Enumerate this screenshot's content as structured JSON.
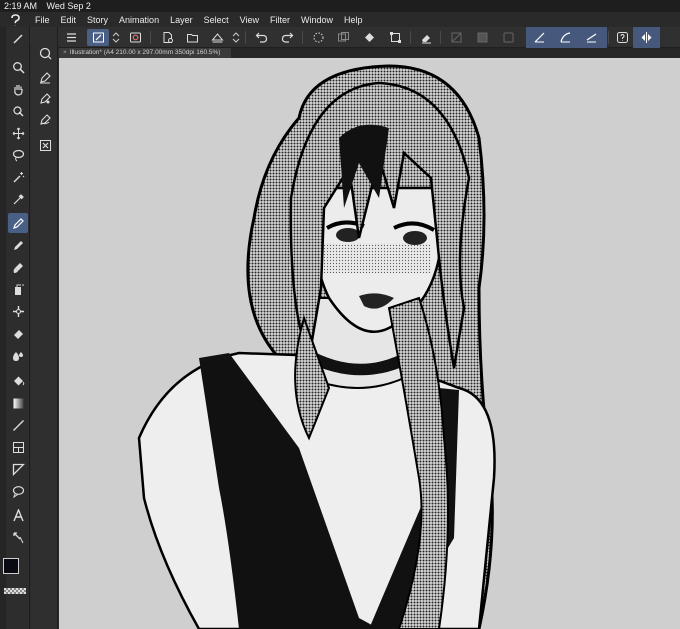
{
  "status": {
    "time": "2:19 AM",
    "date": "Wed Sep 2"
  },
  "menu": [
    "File",
    "Edit",
    "Story",
    "Animation",
    "Layer",
    "Select",
    "View",
    "Filter",
    "Window",
    "Help"
  ],
  "document": {
    "tab_title": "Illustration* (A4 210.00 x 297.00mm 350dpi 160.5%)"
  },
  "colors": {
    "main": "#0a0a14",
    "sub": "#ffffff",
    "accent": "#4a5f86"
  },
  "toolbar_icons": [
    "menu-icon",
    "layer-property-icon",
    "convert-icon",
    "new-icon",
    "open-icon",
    "save-icon",
    "undo-icon",
    "redo-icon",
    "loading-icon",
    "layer-icon",
    "fill-icon",
    "transform-icon",
    "eraser-icon",
    "ruler-snap-icon",
    "contour-snap-icon",
    "perspective-snap-icon",
    "help-icon",
    "flip-icon"
  ],
  "tools": [
    "zoom-icon",
    "hand-icon",
    "rotate-icon",
    "move-icon",
    "lasso-icon",
    "magic-wand-icon",
    "eyedropper-icon",
    "pen-icon",
    "pencil-icon",
    "brush-icon",
    "airbrush-icon",
    "decoration-icon",
    "eraser-icon",
    "blend-icon",
    "fill-icon",
    "gradient-icon",
    "line-icon",
    "frame-icon",
    "ruler-icon",
    "balloon-icon",
    "text-icon",
    "correct-line-icon"
  ]
}
